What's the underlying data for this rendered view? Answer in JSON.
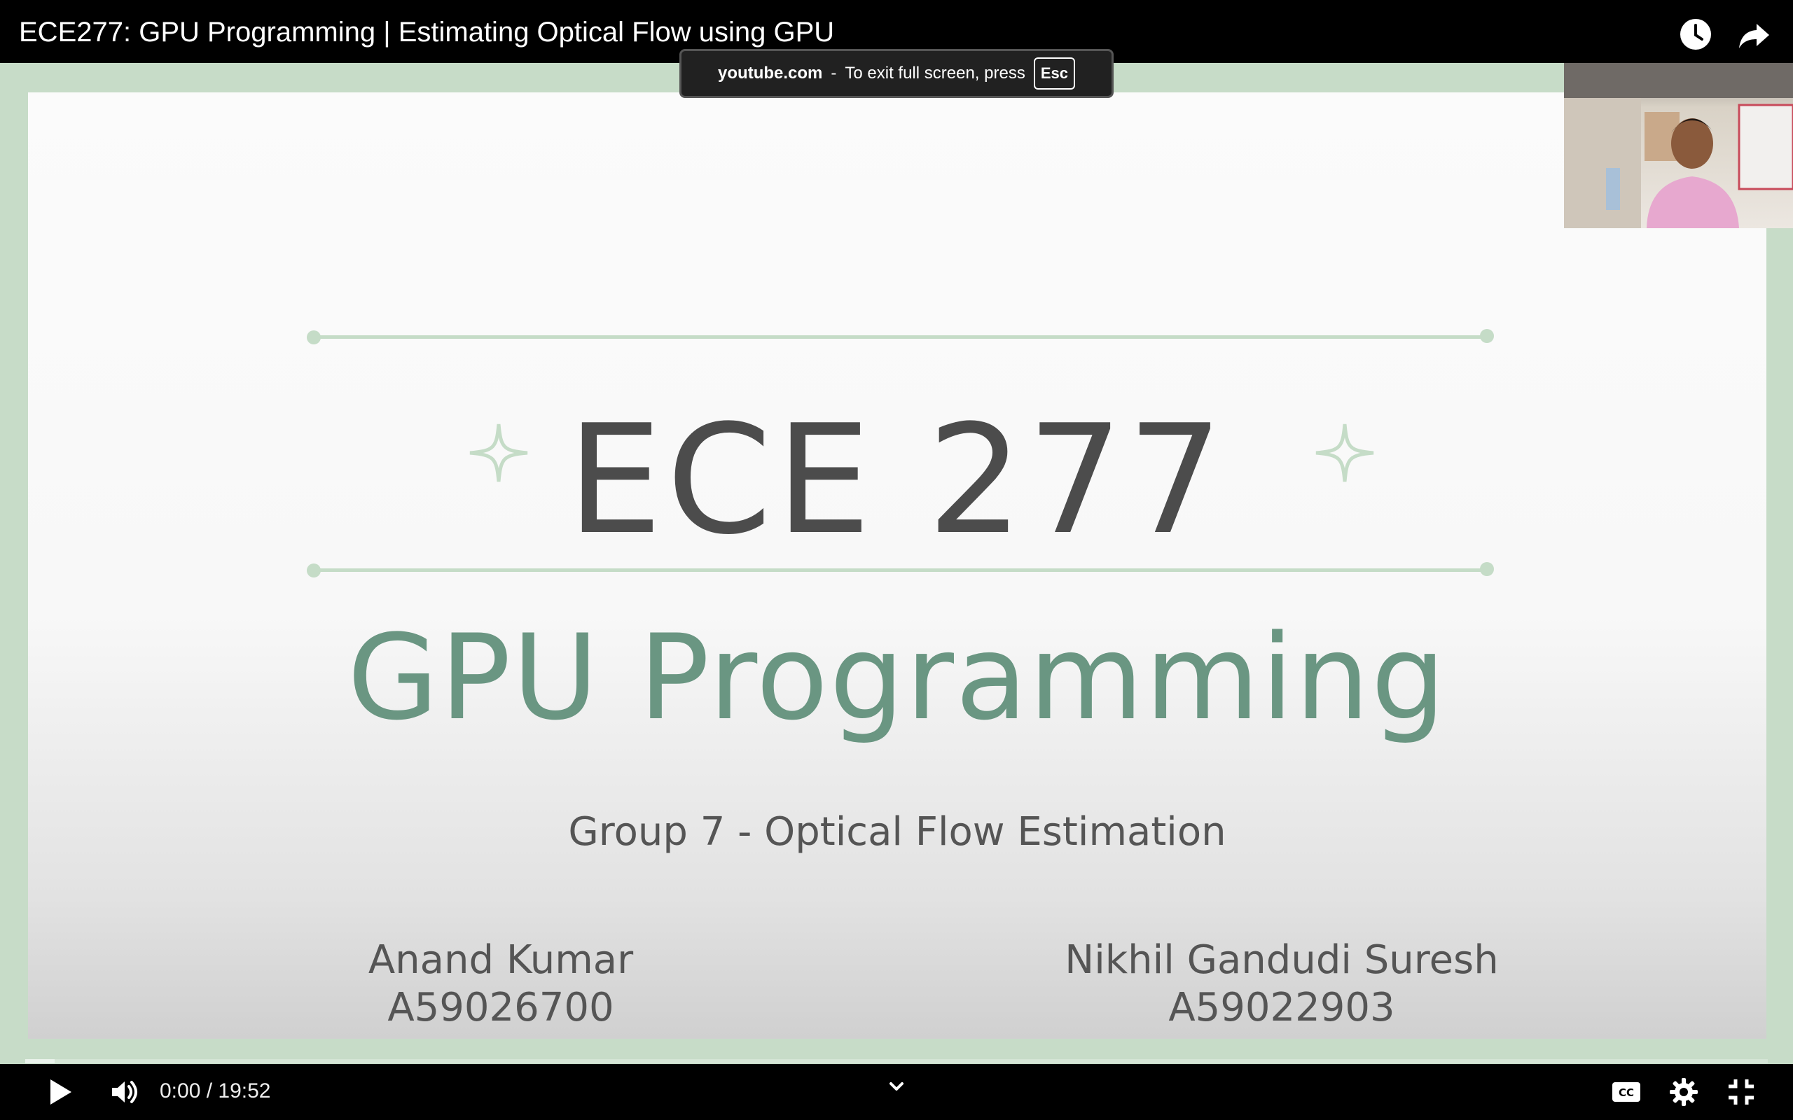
{
  "player": {
    "title": "ECE277: GPU Programming | Estimating Optical Flow using GPU",
    "top_icons": [
      "clock-icon",
      "share-icon"
    ]
  },
  "fullscreen_toast": {
    "domain": "youtube.com",
    "separator": "-",
    "message": "To exit full screen, press",
    "key": "Esc"
  },
  "slide": {
    "title": "ECE 277",
    "subtitle": "GPU Programming",
    "group": "Group 7 - Optical Flow Estimation",
    "authors": [
      {
        "name": "Anand Kumar",
        "id": "A59026700"
      },
      {
        "name": "Nikhil Gandudi Suresh",
        "id": "A59022903"
      }
    ],
    "colors": {
      "title": "#4c4c4c",
      "subtitle": "#6a9682",
      "accent": "#c5dcc7",
      "frame": "#c7dcc8"
    }
  },
  "controls": {
    "current_time": "0:00",
    "duration": "19:52",
    "time_text": "0:00 / 19:52",
    "progress_fraction": 0,
    "icons": [
      "play-icon",
      "volume-icon",
      "chevron-down-icon",
      "captions-icon",
      "settings-icon",
      "exit-fullscreen-icon"
    ],
    "progress_color": "#ff0000"
  }
}
